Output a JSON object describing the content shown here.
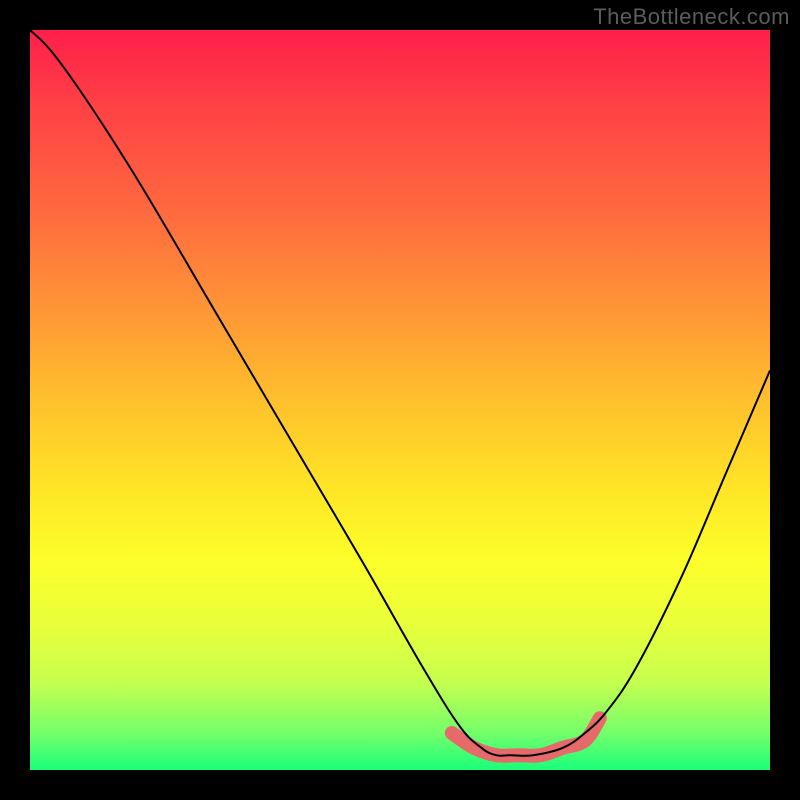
{
  "watermark": "TheBottleneck.com",
  "colors": {
    "background": "#000000",
    "curve": "#000000",
    "bump": "#e66a6a",
    "gradient_top": "#ff1f4a",
    "gradient_mid": "#ffe526",
    "gradient_bottom": "#1aff7a",
    "watermark_color": "#5c5c5c"
  },
  "chart_data": {
    "type": "line",
    "title": "",
    "xlabel": "",
    "ylabel": "",
    "xlim": [
      0,
      100
    ],
    "ylim": [
      0,
      100
    ],
    "grid": false,
    "series": [
      {
        "name": "bottleneck-curve",
        "x": [
          0,
          3,
          8,
          15,
          25,
          35,
          45,
          53,
          58,
          61,
          63,
          65,
          68,
          72,
          75,
          78,
          82,
          88,
          94,
          100
        ],
        "values": [
          100,
          97,
          90,
          79,
          62,
          45,
          28,
          14,
          6,
          3,
          2,
          2,
          2,
          3,
          5,
          8,
          14,
          26,
          40,
          54
        ]
      }
    ],
    "annotations": [
      {
        "name": "optimal-zone-bump",
        "x": [
          57,
          60,
          63,
          66,
          69,
          72,
          75,
          77
        ],
        "values": [
          5,
          3,
          2,
          2,
          2,
          3,
          4,
          7
        ]
      }
    ]
  }
}
